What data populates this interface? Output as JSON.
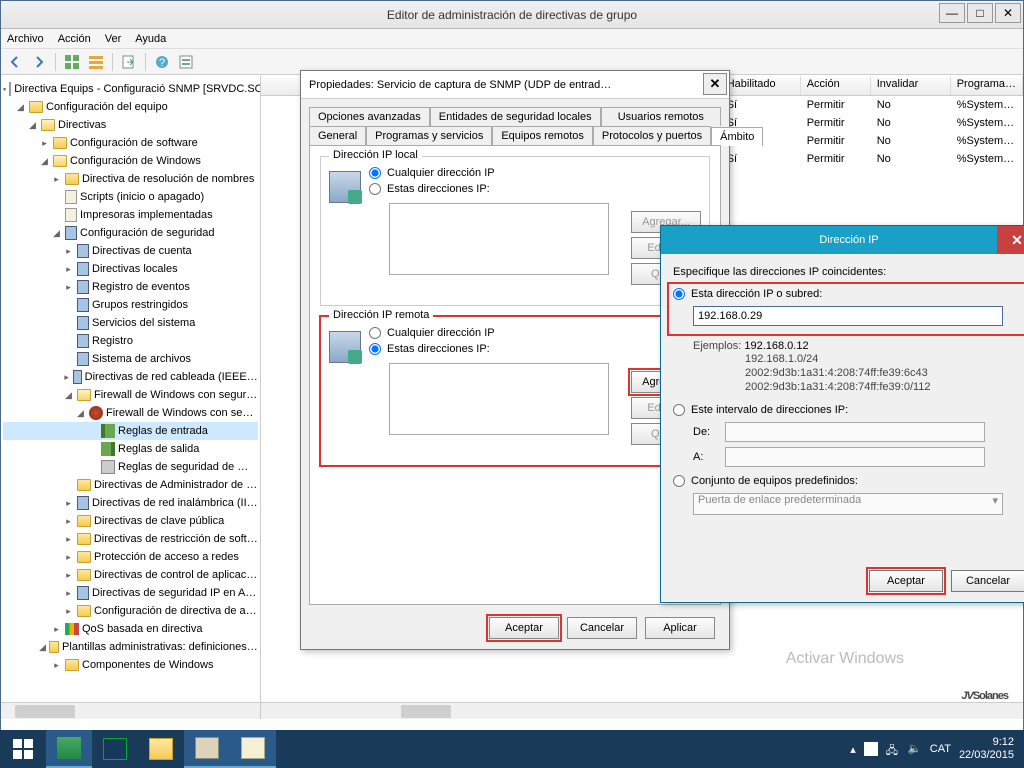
{
  "window": {
    "title": "Editor de administración de directivas de grupo",
    "menu": {
      "archivo": "Archivo",
      "accion": "Acción",
      "ver": "Ver",
      "ayuda": "Ayuda"
    }
  },
  "tree": {
    "root": "Directiva Equips - Configuració SNMP [SRVDC.SO…",
    "conf_equipo": "Configuración del equipo",
    "directivas": "Directivas",
    "conf_soft": "Configuración de software",
    "conf_win": "Configuración de Windows",
    "dir_resol": "Directiva de resolución de nombres",
    "scripts": "Scripts (inicio o apagado)",
    "impresoras": "Impresoras implementadas",
    "conf_seg": "Configuración de seguridad",
    "dir_cuenta": "Directivas de cuenta",
    "dir_locales": "Directivas locales",
    "reg_eventos": "Registro de eventos",
    "grupos_rest": "Grupos restringidos",
    "serv_sist": "Servicios del sistema",
    "registro": "Registro",
    "sist_arch": "Sistema de archivos",
    "red_cable": "Directivas de red cableada (IEEE…",
    "fw_win": "Firewall de Windows con segur…",
    "fw_win2": "Firewall de Windows con se…",
    "reglas_in": "Reglas de entrada",
    "reglas_out": "Reglas de salida",
    "reglas_sec": "Reglas de seguridad de …",
    "dir_admin": "Directivas de Administrador de …",
    "red_inalam": "Directivas de red inalámbrica (II…",
    "clave_pub": "Directivas de clave pública",
    "rest_soft": "Directivas de restricción de soft…",
    "prot_redes": "Protección de acceso a redes",
    "ctrl_aplic": "Directivas de control de aplicac…",
    "seg_ip": "Directivas de seguridad IP en A…",
    "conf_dir_av": "Configuración de directiva de a…",
    "qos": "QoS basada en directiva",
    "plant_admin": "Plantillas administrativas: definiciones…",
    "comp_win": "Componentes de Windows"
  },
  "list": {
    "cols": {
      "hab": "Habilitado",
      "acc": "Acción",
      "inv": "Invalidar",
      "prog": "Programa…"
    },
    "rows": [
      {
        "hab": "Sí",
        "acc": "Permitir",
        "inv": "No",
        "prog": "%System…"
      },
      {
        "hab": "Sí",
        "acc": "Permitir",
        "inv": "No",
        "prog": "%System…"
      },
      {
        "hab": "Sí",
        "acc": "Permitir",
        "inv": "No",
        "prog": "%System…"
      },
      {
        "hab": "Sí",
        "acc": "Permitir",
        "inv": "No",
        "prog": "%System…"
      }
    ]
  },
  "props": {
    "title": "Propiedades: Servicio de captura de SNMP (UDP de entrad…",
    "tabs_row1": {
      "opc": "Opciones avanzadas",
      "ent": "Entidades de seguridad locales",
      "usr": "Usuarios remotos"
    },
    "tabs_row2": {
      "gen": "General",
      "prog": "Programas y servicios",
      "equ": "Equipos remotos",
      "proto": "Protocolos y puertos",
      "amb": "Ámbito"
    },
    "grp_local": "Dirección IP local",
    "grp_remote": "Dirección IP remota",
    "radio_any": "Cualquier dirección IP",
    "radio_these": "Estas direcciones IP:",
    "btn_add": "Agregar...",
    "btn_edit": "Editar...",
    "btn_remove": "Quitar",
    "btn_ok": "Aceptar",
    "btn_cancel": "Cancelar",
    "btn_apply": "Aplicar"
  },
  "ipdlg": {
    "title": "Dirección IP",
    "instr": "Especifique las direcciones IP coincidentes:",
    "opt_subnet": "Esta dirección IP o subred:",
    "ip_value": "192.168.0.29",
    "examples_label": "Ejemplos:",
    "ex1": "192.168.0.12",
    "ex2": "192.168.1.0/24",
    "ex3": "2002:9d3b:1a31:4:208:74ff:fe39:6c43",
    "ex4": "2002:9d3b:1a31:4:208:74ff:fe39:0/112",
    "opt_range": "Este intervalo de direcciones IP:",
    "from": "De:",
    "to": "A:",
    "opt_preset": "Conjunto de equipos predefinidos:",
    "preset_value": "Puerta de enlace predeterminada",
    "btn_ok": "Aceptar",
    "btn_cancel": "Cancelar"
  },
  "watermark": {
    "activate": "Activar Windows",
    "brand": "JVSolanes"
  },
  "taskbar": {
    "lang": "CAT",
    "time": "9:12",
    "date": "22/03/2015"
  }
}
